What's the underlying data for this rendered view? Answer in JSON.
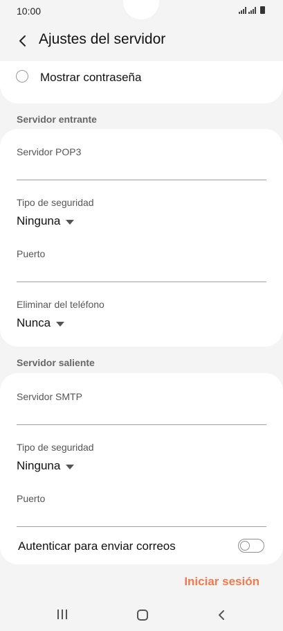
{
  "status_bar": {
    "time": "10:00"
  },
  "app_bar": {
    "title": "Ajustes del servidor"
  },
  "show_password": {
    "label": "Mostrar contraseña"
  },
  "incoming": {
    "header": "Servidor entrante",
    "server_label": "Servidor POP3",
    "server_value": "",
    "security_label": "Tipo de seguridad",
    "security_value": "Ninguna",
    "port_label": "Puerto",
    "port_value": "",
    "delete_label": "Eliminar del teléfono",
    "delete_value": "Nunca"
  },
  "outgoing": {
    "header": "Servidor saliente",
    "server_label": "Servidor SMTP",
    "server_value": "",
    "security_label": "Tipo de seguridad",
    "security_value": "Ninguna",
    "port_label": "Puerto",
    "port_value": "",
    "auth_label": "Autenticar para enviar correos",
    "auth_enabled": false
  },
  "actions": {
    "sign_in": "Iniciar sesión"
  },
  "colors": {
    "accent": "#ef7a4e",
    "background": "#f4f4f4",
    "card": "#ffffff"
  },
  "icons": {
    "back": "chevron-left-icon",
    "radio": "radio-unchecked-icon",
    "dropdown": "caret-down-icon",
    "nav_recent": "recent-apps-icon",
    "nav_home": "home-icon",
    "nav_back": "back-icon"
  }
}
